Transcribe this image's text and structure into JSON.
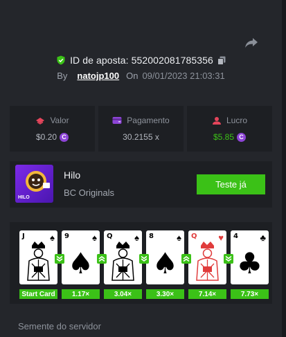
{
  "bet": {
    "id_label": "ID de aposta:",
    "id_value": "552002081785356",
    "by_label": "By",
    "username": "natojp100",
    "on_label": "On",
    "datetime": "09/01/2023 21:03:31"
  },
  "stats": {
    "valor": {
      "label": "Valor",
      "value": "$0.20",
      "icon": "coins-icon"
    },
    "pagamento": {
      "label": "Pagamento",
      "value": "30.2155 x",
      "icon": "wallet-icon"
    },
    "lucro": {
      "label": "Lucro",
      "value": "$5.85",
      "icon": "profit-icon"
    }
  },
  "game": {
    "title": "Hilo",
    "provider": "BC Originals",
    "thumb_text": "HILO",
    "play_label": "Teste já"
  },
  "cards": [
    {
      "rank": "J",
      "suit": "♠",
      "color": "#000000",
      "face": true
    },
    {
      "rank": "9",
      "suit": "♠",
      "color": "#000000",
      "face": false
    },
    {
      "rank": "Q",
      "suit": "♠",
      "color": "#000000",
      "face": true
    },
    {
      "rank": "8",
      "suit": "♠",
      "color": "#000000",
      "face": false
    },
    {
      "rank": "Q",
      "suit": "♥",
      "color": "#e03c3c",
      "face": true
    },
    {
      "rank": "4",
      "suit": "♣",
      "color": "#000000",
      "face": false
    }
  ],
  "arrows": [
    "down",
    "up",
    "down",
    "up",
    "down"
  ],
  "multipliers": [
    "Start Card",
    "1.17×",
    "3.04×",
    "3.30×",
    "7.14×",
    "7.73×"
  ],
  "seed": {
    "label": "Semente do servidor"
  },
  "colors": {
    "accent_green": "#3bc117",
    "coin_purple": "#8d44d6",
    "panel": "#1d1f23",
    "background": "#24262b"
  }
}
